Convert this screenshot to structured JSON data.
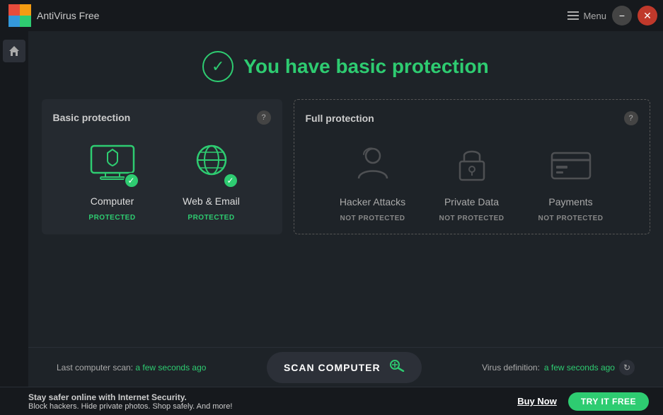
{
  "titlebar": {
    "app_name": "AntiVirus Free",
    "menu_label": "Menu",
    "min_btn": "−",
    "close_btn": "✕"
  },
  "header": {
    "title": "You have basic protection",
    "check_icon": "✓"
  },
  "basic_card": {
    "title": "Basic protection",
    "help": "?",
    "items": [
      {
        "label": "Computer",
        "status": "PROTECTED",
        "protected": true
      },
      {
        "label": "Web & Email",
        "status": "PROTECTED",
        "protected": true
      }
    ]
  },
  "full_card": {
    "title": "Full protection",
    "help": "?",
    "items": [
      {
        "label": "Hacker Attacks",
        "status": "NOT PROTECTED",
        "protected": false
      },
      {
        "label": "Private Data",
        "status": "NOT PROTECTED",
        "protected": false
      },
      {
        "label": "Payments",
        "status": "NOT PROTECTED",
        "protected": false
      }
    ]
  },
  "bottom_bar": {
    "scan_prefix": "Last computer scan: ",
    "scan_time": "a few seconds ago",
    "scan_button": "SCAN COMPUTER",
    "virus_prefix": "Virus definition: ",
    "virus_time": "a few seconds ago"
  },
  "footer": {
    "line1": "Stay safer online with Internet Security.",
    "line2": "Block hackers. Hide private photos. Shop safely. And more!",
    "buy_now": "Buy Now",
    "try_label": "TRY IT FREE"
  }
}
